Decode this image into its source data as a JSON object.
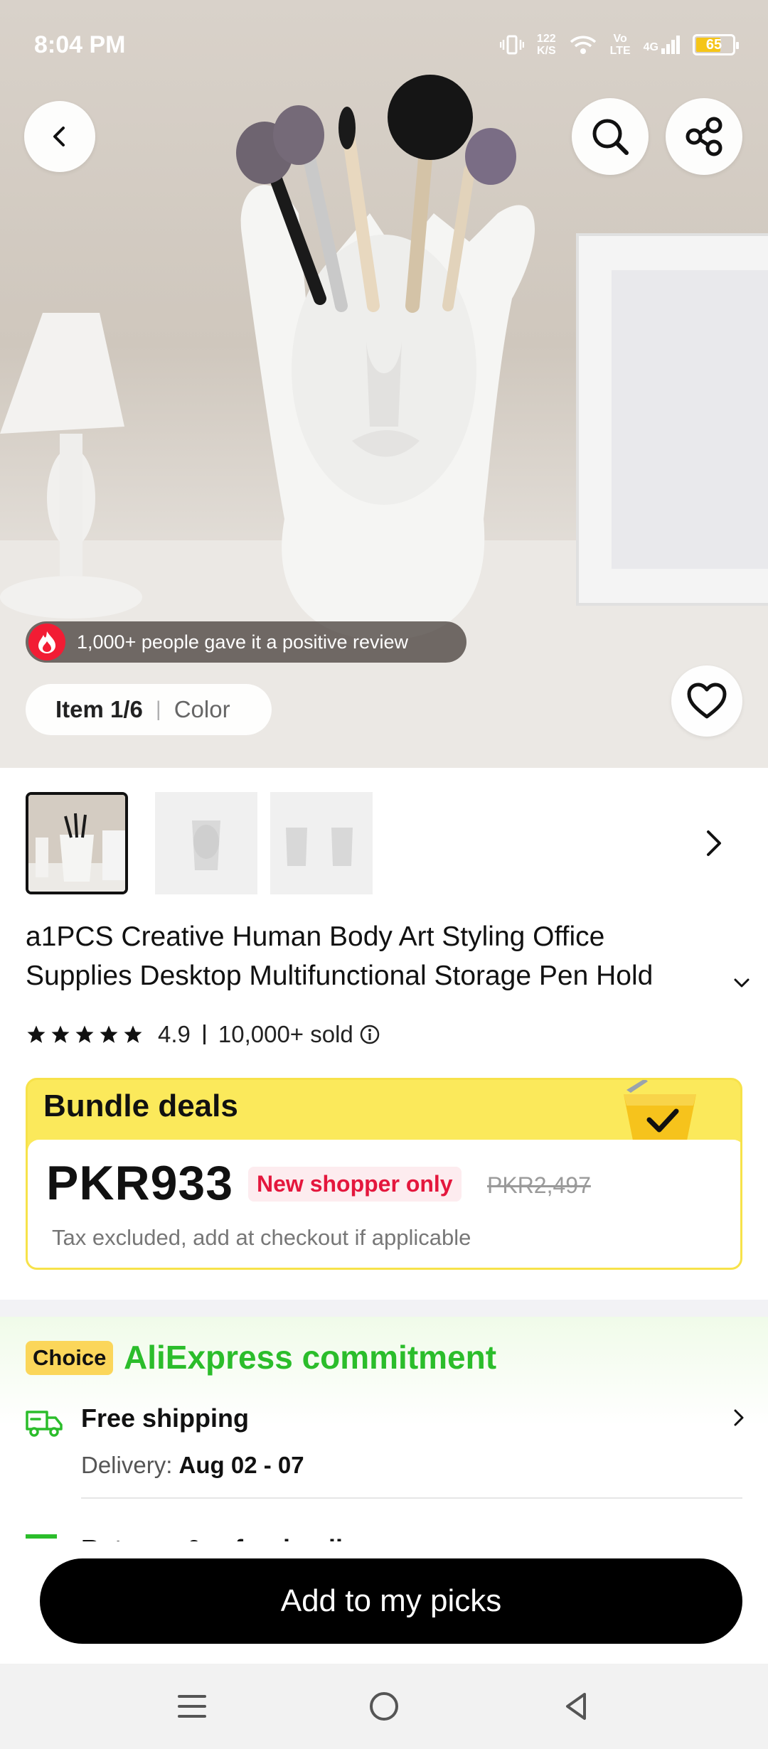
{
  "status_bar": {
    "time": "8:04 PM",
    "speed_value": "122",
    "speed_unit": "K/S",
    "network_label_top": "Vo",
    "network_label_bottom": "LTE",
    "signal_label": "4G",
    "battery": "65"
  },
  "hero": {
    "review_text": "1,000+ people gave it a positive review",
    "item_count": "Item 1/6",
    "item_variant_label": "Color"
  },
  "product": {
    "title_line1": "a1PCS Creative Human Body Art Styling Office",
    "title_line2": "Supplies Desktop Multifunctional Storage Pen Hold",
    "rating": "4.9",
    "sold": "10,000+ sold",
    "star_count": 5
  },
  "bundle": {
    "heading": "Bundle deals",
    "price": "PKR933",
    "badge": "New shopper only",
    "original_price": "PKR2,497",
    "tax_note": "Tax excluded, add at checkout if applicable"
  },
  "commitment": {
    "badge": "Choice",
    "title": "AliExpress commitment",
    "shipping_title": "Free shipping",
    "delivery_label": "Delivery: ",
    "delivery_dates": "Aug 02 - 07",
    "returns_title": "Returns & refund policy"
  },
  "actions": {
    "primary_label": "Add to my picks"
  },
  "colors": {
    "accent_green": "#2bbd2b",
    "sale_red": "#e4173d",
    "bundle_yellow": "#fbe95b"
  }
}
